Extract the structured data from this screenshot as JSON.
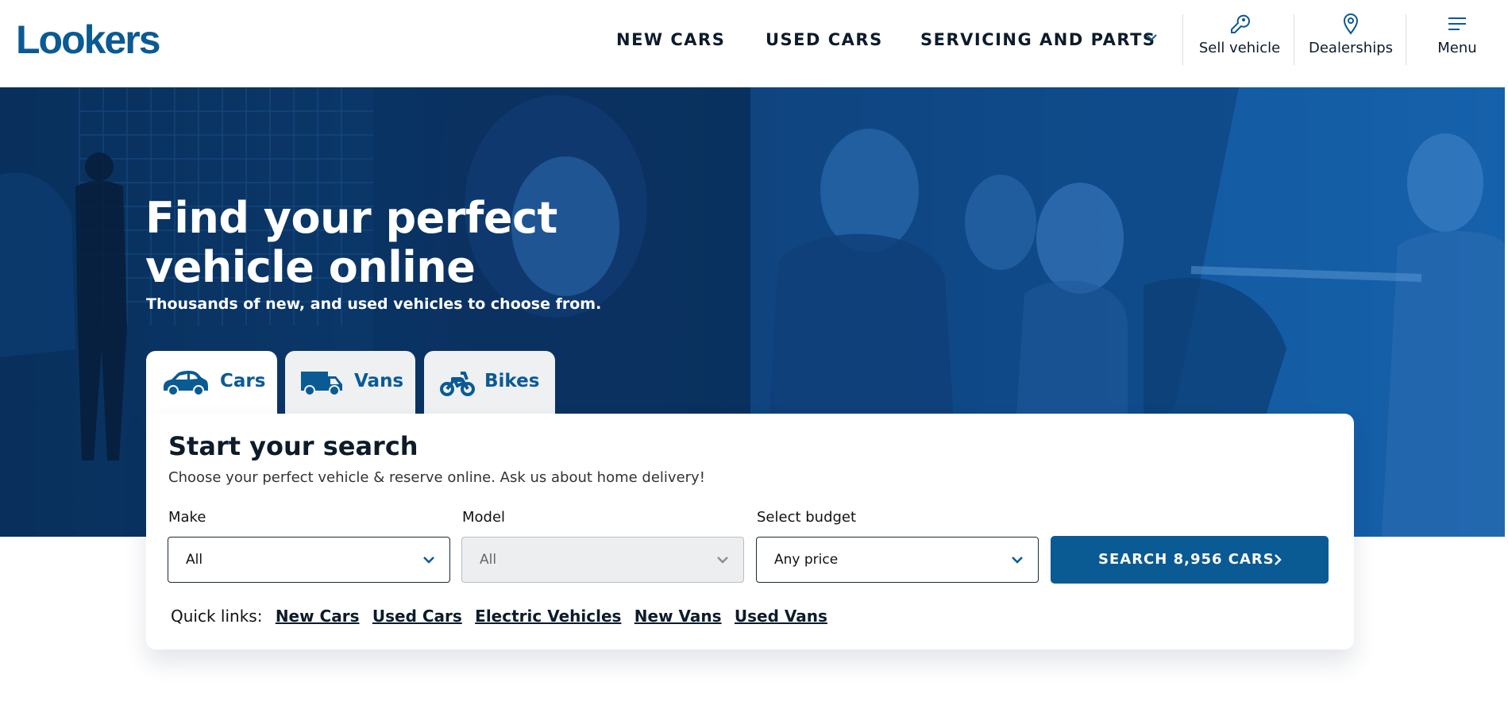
{
  "header": {
    "logo": "Lookers",
    "nav": [
      "NEW CARS",
      "USED CARS",
      "SERVICING AND PARTS"
    ],
    "utilities": [
      {
        "label": "Sell vehicle",
        "icon": "key-icon"
      },
      {
        "label": "Dealerships",
        "icon": "location-pin-icon"
      },
      {
        "label": "Menu",
        "icon": "hamburger-menu-icon"
      }
    ]
  },
  "hero": {
    "title": "Find your perfect vehicle online",
    "subtitle": "Thousands of new, and used vehicles to choose from."
  },
  "tabs": [
    {
      "label": "Cars",
      "icon": "car-icon",
      "active": true
    },
    {
      "label": "Vans",
      "icon": "van-icon",
      "active": false
    },
    {
      "label": "Bikes",
      "icon": "motorbike-icon",
      "active": false
    }
  ],
  "search": {
    "title": "Start your search",
    "subtitle": "Choose your perfect vehicle & reserve online. Ask us about home delivery!",
    "make": {
      "label": "Make",
      "value": "All"
    },
    "model": {
      "label": "Model",
      "value": "All"
    },
    "budget": {
      "label": "Select budget",
      "value": "Any price"
    },
    "button": "SEARCH 8,956 CARS",
    "quick_label": "Quick links:",
    "quick_links": [
      "New Cars",
      "Used Cars",
      "Electric Vehicles",
      "New Vans",
      "Used Vans"
    ]
  },
  "colors": {
    "brand": "#0a5a94",
    "hero_overlay": "#0b3a6e",
    "text_dark": "#0d1b2a"
  }
}
